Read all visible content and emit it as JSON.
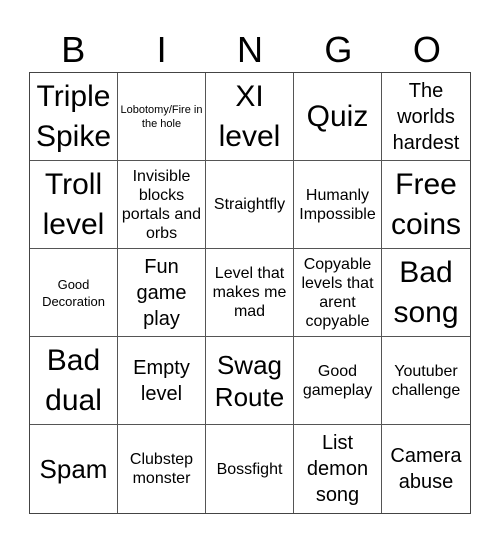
{
  "header": [
    "B",
    "I",
    "N",
    "G",
    "O"
  ],
  "cells": [
    {
      "text": "Triple Spike",
      "size": "xl"
    },
    {
      "text": "Lobotomy/Fire in the hole",
      "size": "xxs"
    },
    {
      "text": "XI level",
      "size": "xl"
    },
    {
      "text": "Quiz",
      "size": "xl"
    },
    {
      "text": "The worlds hardest",
      "size": "m"
    },
    {
      "text": "Troll level",
      "size": "xl"
    },
    {
      "text": "Invisible blocks portals and orbs",
      "size": "sm"
    },
    {
      "text": "Straightfly",
      "size": "sm"
    },
    {
      "text": "Humanly Impossible",
      "size": "sm"
    },
    {
      "text": "Free coins",
      "size": "xl"
    },
    {
      "text": "Good Decoration",
      "size": "xs"
    },
    {
      "text": "Fun game play",
      "size": "m"
    },
    {
      "text": "Level that makes me mad",
      "size": "sm"
    },
    {
      "text": "Copyable levels that arent copyable",
      "size": "sm"
    },
    {
      "text": "Bad song",
      "size": "xl"
    },
    {
      "text": "Bad dual",
      "size": "xl"
    },
    {
      "text": "Empty level",
      "size": "m"
    },
    {
      "text": "Swag Route",
      "size": "l"
    },
    {
      "text": "Good gameplay",
      "size": "sm"
    },
    {
      "text": "Youtuber challenge",
      "size": "sm"
    },
    {
      "text": "Spam",
      "size": "l"
    },
    {
      "text": "Clubstep monster",
      "size": "sm"
    },
    {
      "text": "Bossfight",
      "size": "sm"
    },
    {
      "text": "List demon song",
      "size": "m"
    },
    {
      "text": "Camera abuse",
      "size": "m"
    }
  ]
}
